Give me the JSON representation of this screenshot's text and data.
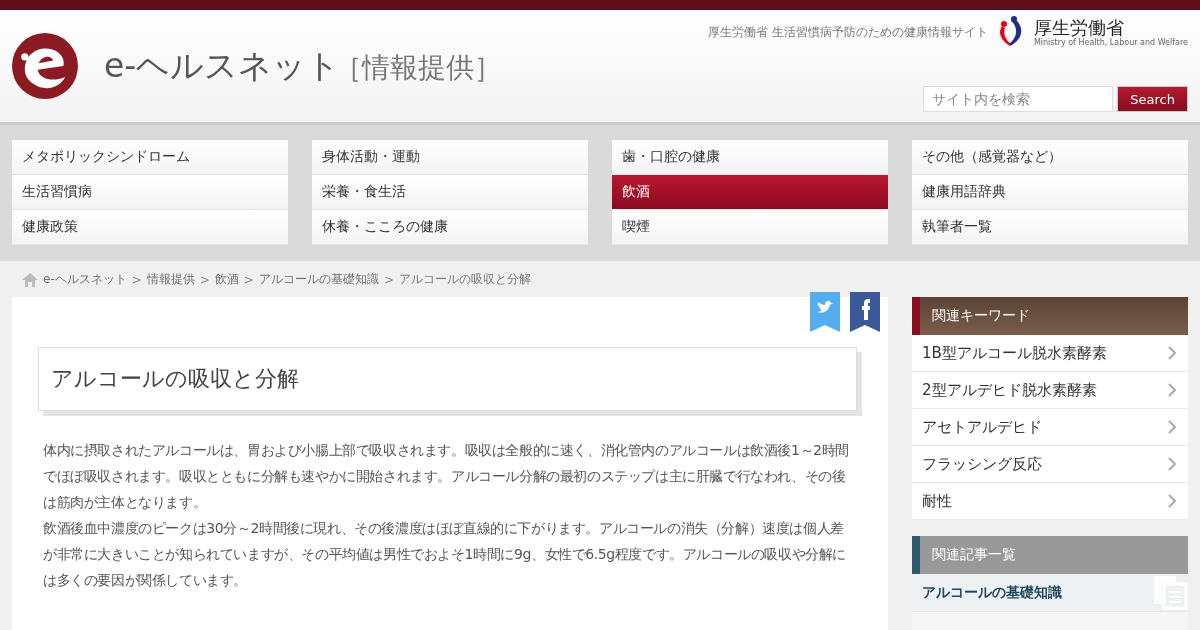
{
  "header": {
    "site_name": "e-ヘルスネット",
    "subtitle": "［情報提供］",
    "tagline": "厚生労働省 生活習慣病予防のための健康情報サイト",
    "ministry_name": "厚生労働省",
    "ministry_english": "Ministry of Health, Labour and Welfare"
  },
  "search": {
    "placeholder": "サイト内を検索",
    "button": "Search"
  },
  "nav": [
    [
      {
        "label": "メタボリックシンドローム",
        "selected": false
      },
      {
        "label": "生活習慣病",
        "selected": false
      },
      {
        "label": "健康政策",
        "selected": false
      }
    ],
    [
      {
        "label": "身体活動・運動",
        "selected": false
      },
      {
        "label": "栄養・食生活",
        "selected": false
      },
      {
        "label": "休養・こころの健康",
        "selected": false
      }
    ],
    [
      {
        "label": "歯・口腔の健康",
        "selected": false
      },
      {
        "label": "飲酒",
        "selected": true
      },
      {
        "label": "喫煙",
        "selected": false
      }
    ],
    [
      {
        "label": "その他（感覚器など）",
        "selected": false
      },
      {
        "label": "健康用語辞典",
        "selected": false
      },
      {
        "label": "執筆者一覧",
        "selected": false
      }
    ]
  ],
  "breadcrumb": [
    {
      "kind": "link",
      "text": "e-ヘルスネット"
    },
    {
      "kind": "separator",
      "text": ">"
    },
    {
      "kind": "link",
      "text": "情報提供"
    },
    {
      "kind": "separator",
      "text": ">"
    },
    {
      "kind": "link",
      "text": "飲酒"
    },
    {
      "kind": "separator",
      "text": ">"
    },
    {
      "kind": "link",
      "text": "アルコールの基礎知識"
    },
    {
      "kind": "separator",
      "text": ">"
    },
    {
      "kind": "current",
      "text": "アルコールの吸収と分解"
    }
  ],
  "article": {
    "title": "アルコールの吸収と分解",
    "paragraphs": [
      "体内に摂取されたアルコールは、胃および小腸上部で吸収されます。吸収は全般的に速く、消化管内のアルコールは飲酒後1～2時間でほぼ吸収されます。吸収とともに分解も速やかに開始されます。アルコール分解の最初のステップは主に肝臓で行なわれ、その後は筋肉が主体となります。",
      "飲酒後血中濃度のピークは30分～2時間後に現れ、その後濃度はほぼ直線的に下がります。アルコールの消失（分解）速度は個人差が非常に大きいことが知られていますが、その平均値は男性でおよそ1時間に9g、女性で6.5g程度です。アルコールの吸収や分解には多くの要因が関係しています。"
    ]
  },
  "keywords": {
    "title": "関連キーワード",
    "items": [
      "1B型アルコール脱水素酵素",
      "2型アルデヒド脱水素酵素",
      "アセトアルデヒド",
      "フラッシング反応",
      "耐性"
    ]
  },
  "related": {
    "title": "関連記事一覧",
    "items": [
      {
        "label": "アルコールの基礎知識",
        "selected": true
      }
    ]
  }
}
